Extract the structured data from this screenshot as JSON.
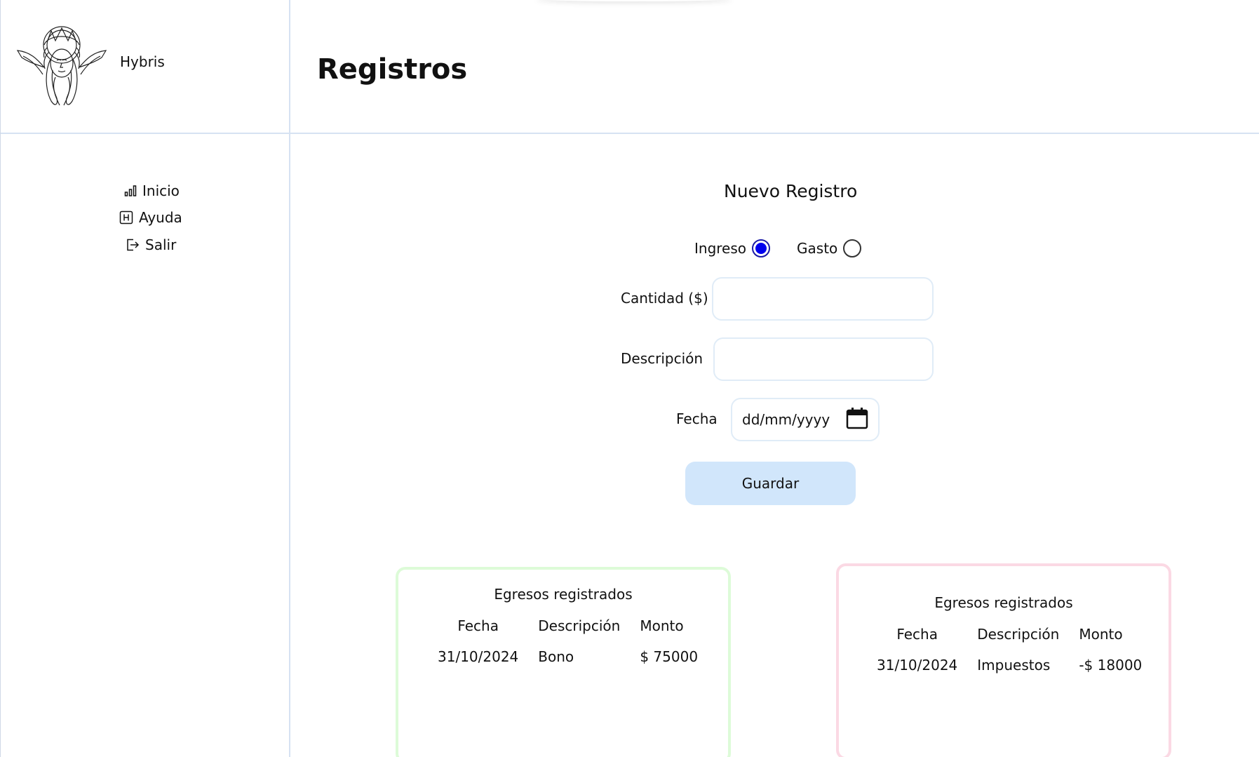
{
  "brand": {
    "name": "Hybris",
    "logo_icon": "goddess-emblem-logo"
  },
  "sidebar": {
    "items": [
      {
        "label": "Inicio",
        "icon": "bar-chart-icon"
      },
      {
        "label": "Ayuda",
        "icon": "help-box-icon"
      },
      {
        "label": "Salir",
        "icon": "logout-icon"
      }
    ]
  },
  "header": {
    "title": "Registros"
  },
  "form": {
    "title": "Nuevo Registro",
    "type_options": [
      {
        "label": "Ingreso",
        "selected": true
      },
      {
        "label": "Gasto",
        "selected": false
      }
    ],
    "amount_label": "Cantidad ($)",
    "amount_value": "",
    "description_label": "Descripción",
    "description_value": "",
    "date_label": "Fecha",
    "date_placeholder": "dd/mm/yyyy",
    "save_label": "Guardar"
  },
  "income_table": {
    "title": "Egresos registrados",
    "columns": [
      "Fecha",
      "Descripción",
      "Monto"
    ],
    "rows": [
      {
        "fecha": "31/10/2024",
        "descripcion": "Bono",
        "monto": "$ 75000"
      }
    ],
    "border_color": "#ddfbd8"
  },
  "expense_table": {
    "title": "Egresos registrados",
    "columns": [
      "Fecha",
      "Descripción",
      "Monto"
    ],
    "rows": [
      {
        "fecha": "31/10/2024",
        "descripcion": "Impuestos",
        "monto": "-$ 18000"
      }
    ],
    "border_color": "#fbd9e4"
  },
  "colors": {
    "divider": "#d6e2f2",
    "save_button_bg": "#d1e6fb",
    "radio_selected": "#0000ee"
  }
}
